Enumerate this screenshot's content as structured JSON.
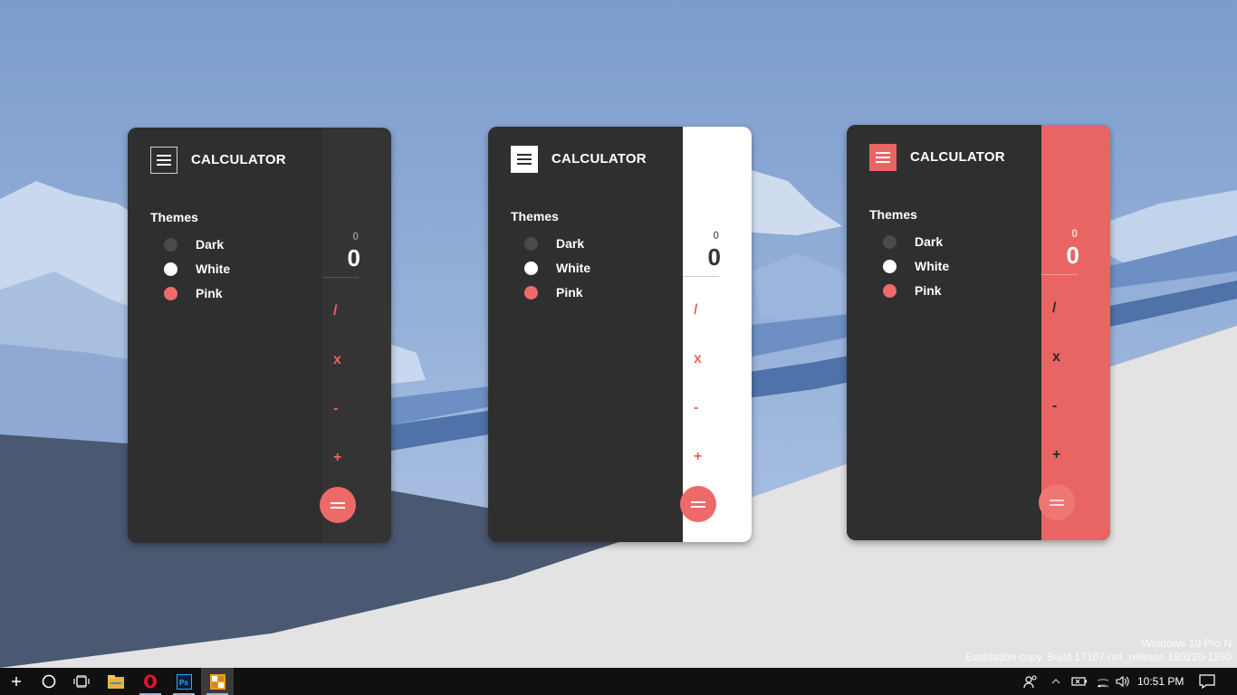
{
  "desktop": {
    "watermark": {
      "line1": "Windows 10 Pro N",
      "line2": "Evaluation copy. Build 17107.rs4_release.180220-1350"
    }
  },
  "calculators": [
    {
      "theme": "dark",
      "title": "CALCULATOR",
      "themes_label": "Themes",
      "theme_options": [
        "Dark",
        "White",
        "Pink"
      ],
      "display_previous": "0",
      "display_result": "0",
      "operators": [
        "/",
        "x",
        "-",
        "+"
      ],
      "equals_icon": "equals-icon",
      "colors": {
        "panel": "#343434",
        "operators": "#e96462",
        "equals_bg": "#ee6a68",
        "display": "#ffffff"
      }
    },
    {
      "theme": "white",
      "title": "CALCULATOR",
      "themes_label": "Themes",
      "theme_options": [
        "Dark",
        "White",
        "Pink"
      ],
      "display_previous": "0",
      "display_result": "0",
      "operators": [
        "/",
        "x",
        "-",
        "+"
      ],
      "equals_icon": "equals-icon",
      "colors": {
        "panel": "#ffffff",
        "operators": "#e96462",
        "equals_bg": "#ee6a68",
        "display": "#333333"
      }
    },
    {
      "theme": "pink",
      "title": "CALCULATOR",
      "themes_label": "Themes",
      "theme_options": [
        "Dark",
        "White",
        "Pink"
      ],
      "display_previous": "0",
      "display_result": "0",
      "operators": [
        "/",
        "x",
        "-",
        "+"
      ],
      "equals_icon": "equals-icon",
      "colors": {
        "panel": "#e86563",
        "operators": "#2b2b2b",
        "equals_bg": "#ee7673",
        "display": "#ffffff"
      }
    }
  ],
  "theme_dot_colors": {
    "Dark": "#4a4a4a",
    "White": "#ffffff",
    "Pink": "#ef6b6a"
  },
  "taskbar": {
    "apps": [
      "start-icon",
      "cortana-icon",
      "task-view-icon",
      "file-explorer-icon",
      "opera-icon",
      "photoshop-icon",
      "calculator-app-icon"
    ],
    "tray_icons": [
      "people-icon",
      "chevron-up-icon",
      "battery-icon",
      "wifi-icon",
      "volume-icon"
    ],
    "time": "10:51 PM",
    "action_center_icon": "action-center-icon"
  }
}
